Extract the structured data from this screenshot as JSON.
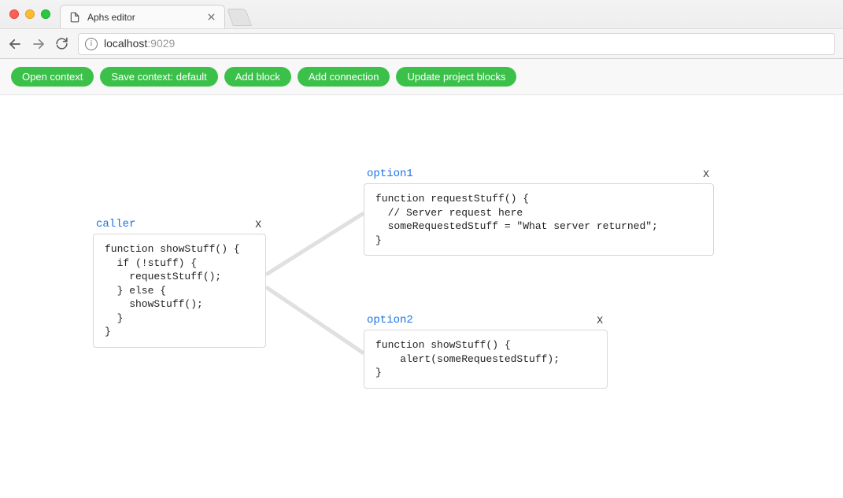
{
  "browser": {
    "tab_title": "Aphs editor",
    "url_host": "localhost",
    "url_port": ":9029"
  },
  "toolbar": {
    "open_context": "Open context",
    "save_context": "Save context: default",
    "add_block": "Add block",
    "add_connection": "Add connection",
    "update_blocks": "Update project blocks"
  },
  "blocks": {
    "caller": {
      "title": "caller",
      "close": "X",
      "code": "function showStuff() {\n  if (!stuff) {\n    requestStuff();\n  } else {\n    showStuff();\n  }\n}"
    },
    "option1": {
      "title": "option1",
      "close": "X",
      "code": "function requestStuff() {\n  // Server request here\n  someRequestedStuff = \"What server returned\";\n}"
    },
    "option2": {
      "title": "option2",
      "close": "X",
      "code": "function showStuff() {\n    alert(someRequestedStuff);\n}"
    }
  }
}
